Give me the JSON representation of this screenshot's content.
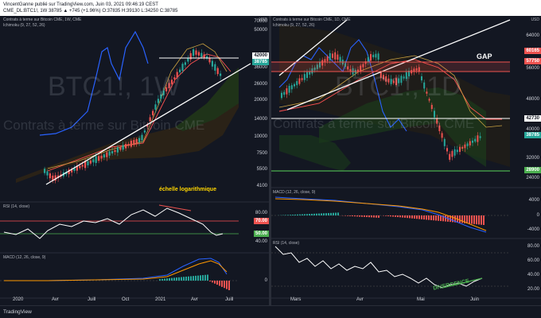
{
  "header": {
    "author_line": "VincentGanne publié sur TradingView.com, Juin 03, 2021 09:46:19 CEST",
    "symbol_line": "CME_DL:BTC1!, 1W  38785  ▲ +745 (+1.96%) O:37835  H:39130  L:34250  C:38785"
  },
  "left": {
    "title": "Contrats à terme sur Bitcoin CME, 1W, CME",
    "indicator": "Ichimoku (9, 27, 52, 26)",
    "currency": "USD",
    "watermark_main": "BTC1!, 1W",
    "watermark_sub": "Contrats à terme sur Bitcoin CME",
    "annotation": "échelle logarithmique",
    "y_ticks": [
      "70000",
      "50000",
      "36000",
      "26000",
      "20000",
      "14000",
      "10000",
      "7500",
      "5500",
      "4100"
    ],
    "tag_42000": "42000",
    "tag_38785": "38785",
    "rsi_title": "RSI (14, close)",
    "rsi_ticks": [
      "80.00",
      "70.00",
      "50.00",
      "40.00"
    ],
    "macd_title": "MACD (12, 26, close, 9)",
    "macd_ticks": [
      "0"
    ],
    "x_ticks": [
      "2020",
      "Avr",
      "Juill",
      "Oct",
      "2021",
      "Avr",
      "Juill"
    ]
  },
  "right": {
    "title": "CME_DL:BTC1!, 1D  38785  ▲ +745 (+1.96%) O:37835 H:39130 L:37255 C:38785",
    "title2": "Contrats à terme sur Bitcoin CME, 1D, CME",
    "indicator": "Ichimoku (9, 27, 52, 26)",
    "currency": "USD",
    "watermark_main": "BTC1!, 1D",
    "watermark_sub": "Contrats à terme sur Bitcoin CME",
    "gap_label": "GAP",
    "y_ticks": [
      "64000",
      "56000",
      "48000",
      "40000",
      "32000",
      "24000"
    ],
    "tag_60165": "60165",
    "tag_57750": "57750",
    "tag_42730": "42730",
    "tag_38785": "38785",
    "tag_28900": "28900",
    "macd_title": "MACD (12, 26, close, 9)",
    "macd_ticks": [
      "4000",
      "0",
      "-4000"
    ],
    "rsi_title": "RSI (14, close)",
    "rsi_ticks": [
      "80.00",
      "60.00",
      "40.00",
      "20.00"
    ],
    "divergence": "DIVERGENCE",
    "x_ticks": [
      "Mars",
      "Avr",
      "Mai",
      "Juin"
    ]
  },
  "footer": {
    "brand": "TradingView"
  },
  "colors": {
    "bg": "#131722",
    "up": "#26a69a",
    "down": "#ef5350",
    "blue": "#2962ff",
    "green_line": "#4caf50",
    "red_line": "#ff5252",
    "cloud": "#1b3a1b"
  }
}
